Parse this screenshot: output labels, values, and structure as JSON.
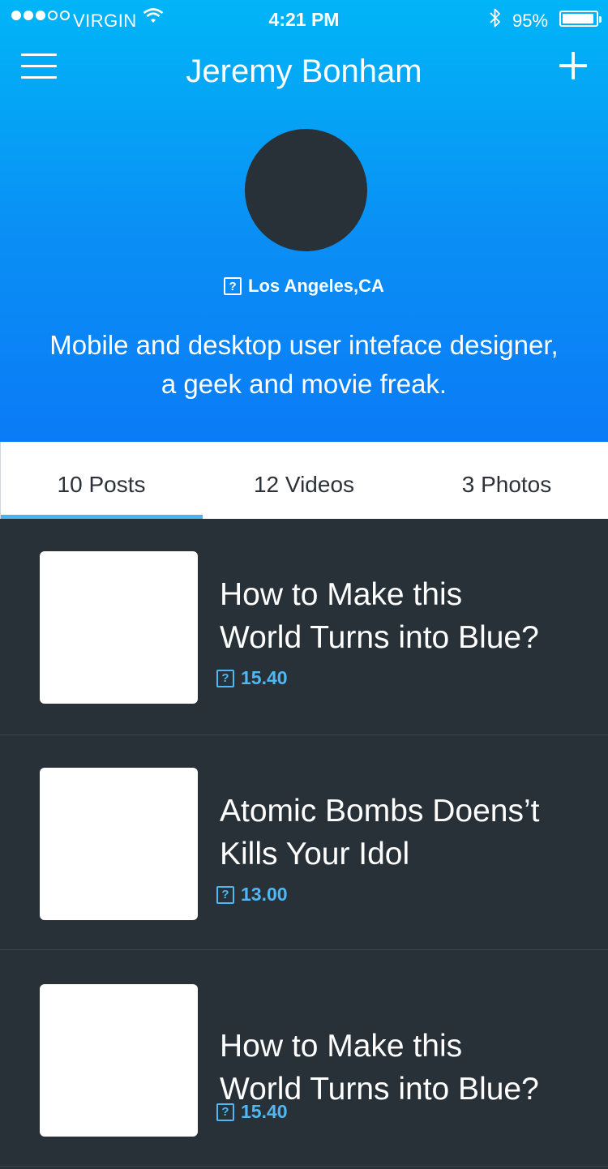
{
  "status_bar": {
    "carrier": "VIRGIN",
    "signal_bars_filled": 3,
    "signal_bars_total": 5,
    "time": "4:21 PM",
    "battery_percent": "95%",
    "icons": [
      "signal-dots-icon",
      "wifi-icon",
      "bluetooth-icon",
      "battery-icon"
    ]
  },
  "nav": {
    "title": "Jeremy Bonham",
    "menu_icon": "hamburger-menu-icon",
    "add_icon": "plus-icon"
  },
  "profile": {
    "location_icon": "unknown-glyph-icon",
    "location": "Los Angeles,CA",
    "bio_line1": "Mobile and desktop user inteface designer,",
    "bio_line2": "a geek and movie freak."
  },
  "tabs": [
    {
      "label": "10 Posts",
      "active": true
    },
    {
      "label": "12 Videos",
      "active": false
    },
    {
      "label": "3 Photos",
      "active": false
    }
  ],
  "posts": [
    {
      "title_line1": "How to Make this",
      "title_line2": "World Turns into Blue?",
      "meta": "15.40",
      "meta_icon": "unknown-glyph-icon"
    },
    {
      "title_line1": "Atomic Bombs Doens’t",
      "title_line2": "Kills Your Idol",
      "meta": "13.00",
      "meta_icon": "unknown-glyph-icon"
    },
    {
      "title_line1": "How to Make this",
      "title_line2": "World Turns into Blue?",
      "meta": "15.40",
      "meta_icon": "unknown-glyph-icon"
    }
  ],
  "colors": {
    "header_top": "#01b5f7",
    "header_bottom": "#0a7bf6",
    "background": "#283038",
    "accent": "#4bb4f0"
  }
}
